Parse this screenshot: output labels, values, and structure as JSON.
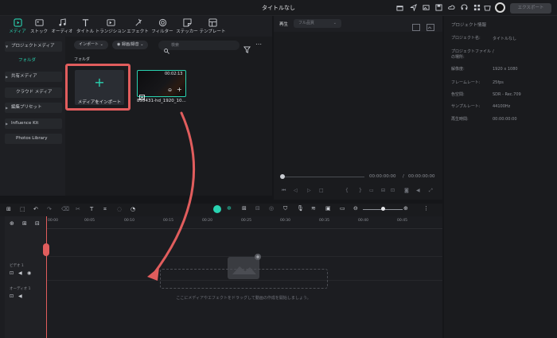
{
  "window": {
    "title": "タイトルなし",
    "export_label": "エクスポート"
  },
  "toolbar": {
    "tools": [
      {
        "label": "メディア",
        "icon": "media-icon",
        "active": true
      },
      {
        "label": "ストック",
        "icon": "stock-icon"
      },
      {
        "label": "オーディオ",
        "icon": "audio-icon"
      },
      {
        "label": "タイトル",
        "icon": "title-icon"
      },
      {
        "label": "トランジション",
        "icon": "transition-icon"
      },
      {
        "label": "エフェクト",
        "icon": "effect-icon"
      },
      {
        "label": "フィルター",
        "icon": "filter-icon"
      },
      {
        "label": "ステッカー",
        "icon": "sticker-icon"
      },
      {
        "label": "テンプレート",
        "icon": "template-icon"
      }
    ]
  },
  "sidebar": {
    "items": [
      {
        "label": "プロジェクトメディア",
        "expandable": true,
        "boxed": true
      },
      {
        "label": "フォルダ",
        "selected": true
      },
      {
        "label": "共有メディア",
        "expandable": true,
        "boxed": true
      },
      {
        "label": "クラウド メディア",
        "boxed": true
      },
      {
        "label": "編集プリセット",
        "expandable": true,
        "boxed": true
      },
      {
        "label": "Influence Kit",
        "expandable": true,
        "boxed": true
      },
      {
        "label": "Photos Library",
        "boxed": true
      }
    ]
  },
  "media": {
    "import_dropdown": "インポート",
    "record_dropdown": "録画/録音",
    "search_placeholder": "検索",
    "folder_label": "フォルダ",
    "import_tile_label": "メディアをインポート",
    "clip": {
      "name": "855431-hd_1920_10...",
      "duration": "00:02:13"
    }
  },
  "player": {
    "tab_label": "再生",
    "quality": "フル品質",
    "current_time": "00:00:00:00",
    "separator": "/",
    "total_time": "00:00:00:00"
  },
  "properties": {
    "title": "プロジェクト情報",
    "rows": [
      {
        "label": "プロジェクト名:",
        "value": "タイトルなし"
      },
      {
        "label": "プロジェクトファイルの場所:",
        "value": "/"
      },
      {
        "label": "解像度:",
        "value": "1920 x 1080"
      },
      {
        "label": "フレームレート:",
        "value": "25fps"
      },
      {
        "label": "色空間:",
        "value": "SDR - Rec.709"
      },
      {
        "label": "サンプルレート:",
        "value": "44100Hz"
      },
      {
        "label": "再生時間:",
        "value": "00:00:00:00"
      }
    ]
  },
  "timeline": {
    "ruler": [
      "00:00",
      "00:05",
      "00:10",
      "00:15",
      "00:20",
      "00:25",
      "00:30",
      "00:35",
      "00:40",
      "00:45"
    ],
    "video_track_label": "ビデオ 1",
    "audio_track_label": "オーディオ 1",
    "drop_hint": "ここにメディアやエフェクトをドラッグして動画の作成を開始しましょう。"
  },
  "colors": {
    "accent": "#29d3b1",
    "highlight": "#e15d5d",
    "background": "#151619"
  }
}
